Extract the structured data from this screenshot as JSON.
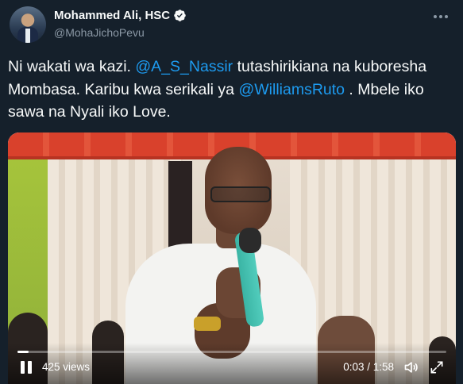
{
  "author": {
    "name": "Mohammed Ali, HSC",
    "handle": "@MohaJichoPevu",
    "verified": true
  },
  "tweet": {
    "segments": [
      {
        "text": "Ni wakati wa kazi. ",
        "type": "text"
      },
      {
        "text": "@A_S_Nassir",
        "type": "mention"
      },
      {
        "text": " tutashirikiana na kuboresha Mombasa. Karibu kwa serikali ya ",
        "type": "text"
      },
      {
        "text": "@WilliamsRuto",
        "type": "mention"
      },
      {
        "text": " . Mbele iko sawa na Nyali iko Love.",
        "type": "text"
      }
    ]
  },
  "video": {
    "views": "425 views",
    "time": "0:03 / 1:58",
    "progress": 0.025,
    "state": "playing"
  },
  "colors": {
    "background": "#15202b",
    "text": "#f7f9f9",
    "secondary": "#8b98a5",
    "link": "#1d9bf0"
  }
}
